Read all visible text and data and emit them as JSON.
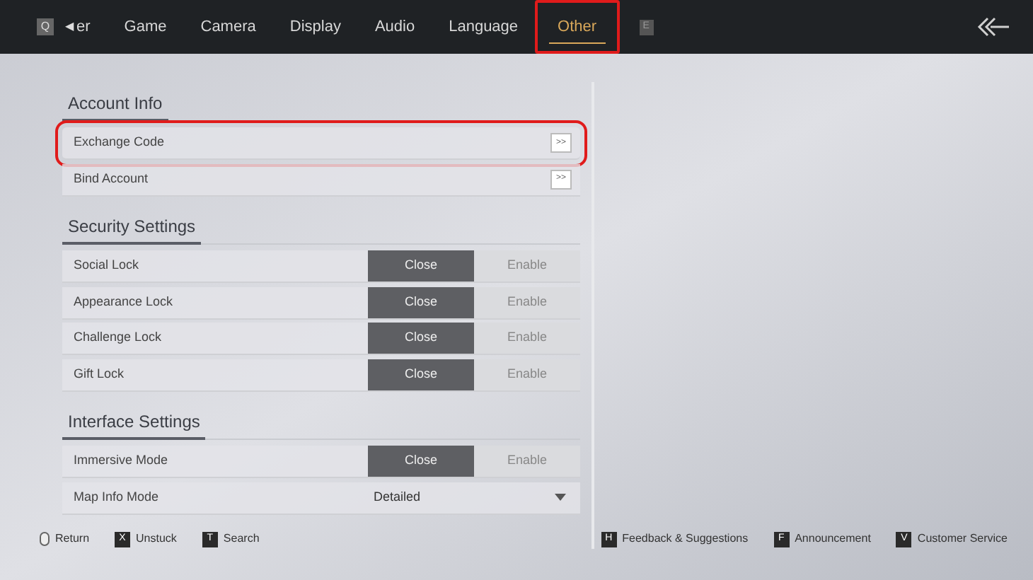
{
  "tabs": {
    "prev_key": "Q",
    "prev_arrow": "◀",
    "items": [
      {
        "label": "er",
        "selected": false,
        "highlighted": false
      },
      {
        "label": "Game",
        "selected": false,
        "highlighted": false
      },
      {
        "label": "Camera",
        "selected": false,
        "highlighted": false
      },
      {
        "label": "Display",
        "selected": false,
        "highlighted": false
      },
      {
        "label": "Audio",
        "selected": false,
        "highlighted": false
      },
      {
        "label": "Language",
        "selected": false,
        "highlighted": false
      },
      {
        "label": "Other",
        "selected": true,
        "highlighted": true
      }
    ],
    "next_key": "E"
  },
  "sections": [
    {
      "title": "Account Info",
      "rows": [
        {
          "kind": "link",
          "label": "Exchange Code",
          "button": ">>",
          "highlighted": true
        },
        {
          "kind": "link",
          "label": "Bind Account",
          "button": ">>",
          "highlighted": false
        }
      ]
    },
    {
      "title": "Security Settings",
      "rows": [
        {
          "kind": "toggle",
          "label": "Social Lock",
          "options": [
            {
              "label": "Close",
              "selected": true
            },
            {
              "label": "Enable",
              "selected": false
            }
          ]
        },
        {
          "kind": "toggle",
          "label": "Appearance Lock",
          "options": [
            {
              "label": "Close",
              "selected": true
            },
            {
              "label": "Enable",
              "selected": false
            }
          ]
        },
        {
          "kind": "toggle",
          "label": "Challenge Lock",
          "options": [
            {
              "label": "Close",
              "selected": true
            },
            {
              "label": "Enable",
              "selected": false
            }
          ]
        },
        {
          "kind": "toggle",
          "label": "Gift Lock",
          "options": [
            {
              "label": "Close",
              "selected": true
            },
            {
              "label": "Enable",
              "selected": false
            }
          ]
        }
      ]
    },
    {
      "title": "Interface Settings",
      "rows": [
        {
          "kind": "toggle",
          "label": "Immersive Mode",
          "options": [
            {
              "label": "Close",
              "selected": true
            },
            {
              "label": "Enable",
              "selected": false
            }
          ]
        },
        {
          "kind": "dropdown",
          "label": "Map Info Mode",
          "value": "Detailed"
        }
      ]
    }
  ],
  "footer": {
    "left": [
      {
        "kind": "mouse",
        "label": "Return"
      },
      {
        "kind": "key",
        "key": "X",
        "label": "Unstuck"
      },
      {
        "kind": "key",
        "key": "T",
        "label": "Search"
      }
    ],
    "right": [
      {
        "kind": "key",
        "key": "H",
        "label": "Feedback & Suggestions"
      },
      {
        "kind": "key",
        "key": "F",
        "label": "Announcement"
      },
      {
        "kind": "key",
        "key": "V",
        "label": "Customer Service"
      }
    ]
  }
}
